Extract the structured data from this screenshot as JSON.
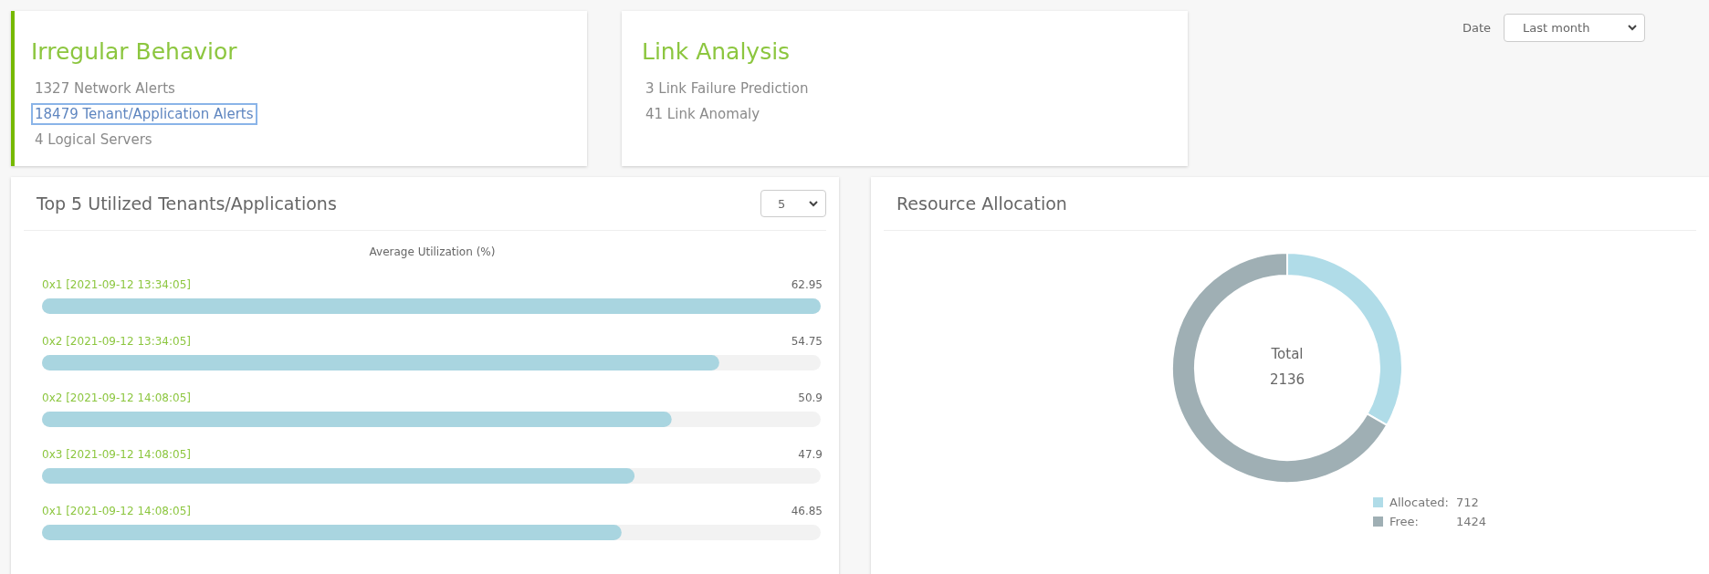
{
  "summary_cards": [
    {
      "title": "Irregular Behavior",
      "accent": true,
      "items": [
        {
          "text": "1327 Network Alerts",
          "focused": false
        },
        {
          "text": "18479 Tenant/Application Alerts",
          "focused": true
        },
        {
          "text": "4 Logical Servers",
          "focused": false
        }
      ]
    },
    {
      "title": "Link Analysis",
      "accent": false,
      "items": [
        {
          "text": "3 Link Failure Prediction",
          "focused": false
        },
        {
          "text": "41 Link Anomaly",
          "focused": false
        }
      ]
    }
  ],
  "date_filter": {
    "label": "Date",
    "value": "Last month"
  },
  "utilization_panel": {
    "title": "Top 5 Utilized Tenants/Applications",
    "count_select": "5",
    "chart_data": {
      "type": "bar",
      "orientation": "horizontal",
      "title": "Average Utilization (%)",
      "categories": [
        "0x1 [2021-09-12 13:34:05]",
        "0x2 [2021-09-12 13:34:05]",
        "0x2 [2021-09-12 14:08:05]",
        "0x3 [2021-09-12 14:08:05]",
        "0x1 [2021-09-12 14:08:05]"
      ],
      "values": [
        62.95,
        54.75,
        50.9,
        47.9,
        46.85
      ],
      "xlim": [
        0,
        62.95
      ],
      "data_labels": true
    }
  },
  "allocation_panel": {
    "title": "Resource Allocation",
    "center_label": "Total",
    "center_value": "2136",
    "chart_data": {
      "type": "donut",
      "values": [
        33.33,
        66.67
      ],
      "colors": [
        "#b0dce8",
        "#9fafb4"
      ]
    },
    "legend": [
      {
        "label": "Allocated:",
        "value": "712",
        "color": "#b0dce8"
      },
      {
        "label": "Free:",
        "value": "1424",
        "color": "#9fafb4"
      }
    ]
  }
}
